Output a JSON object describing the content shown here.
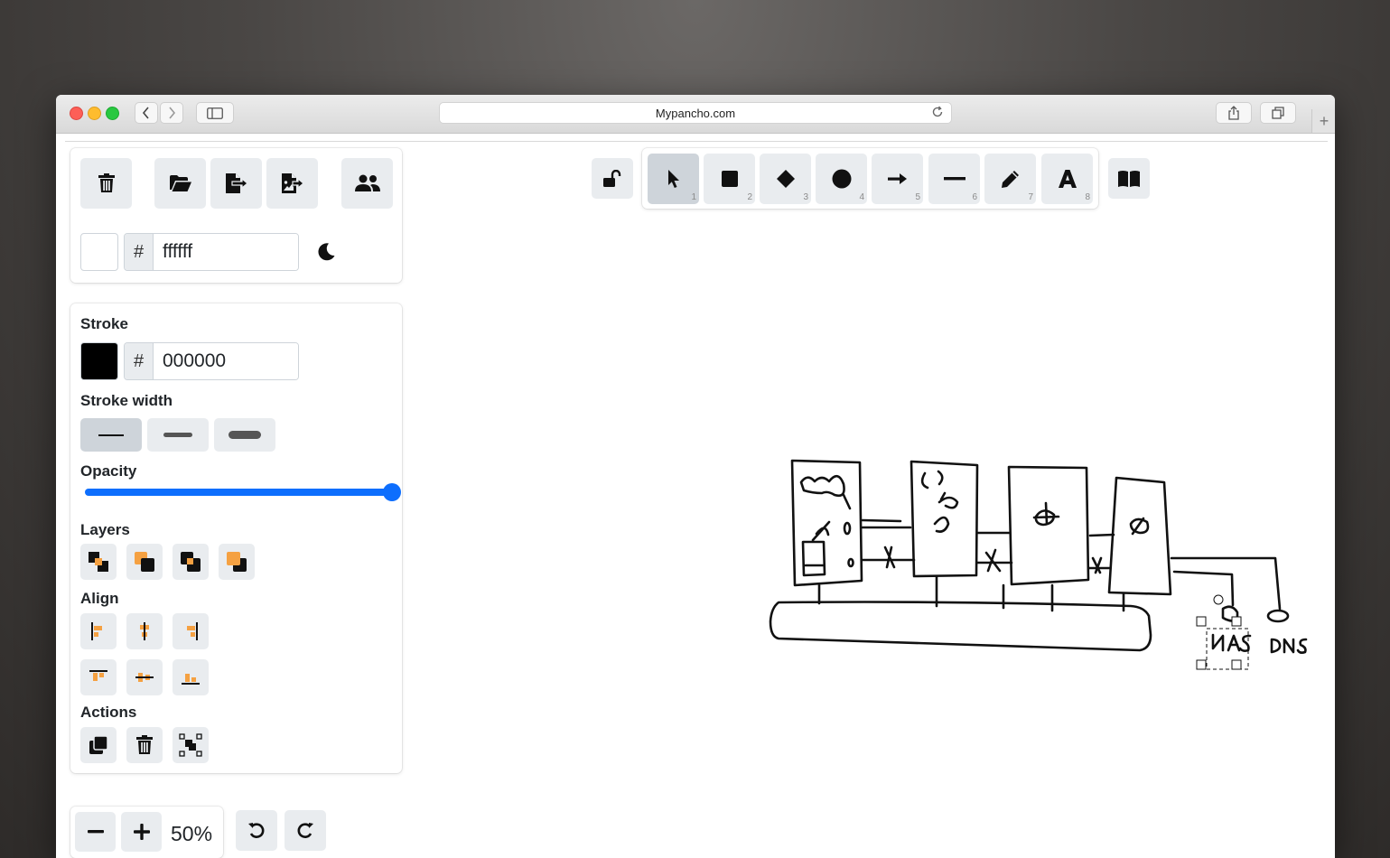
{
  "browser": {
    "url": "Mypancho.com"
  },
  "file_panel": {
    "background_hex": "ffffff",
    "background_color": "#ffffff",
    "icons": [
      "trash-icon",
      "folder-open-icon",
      "file-export-icon",
      "image-export-icon",
      "users-icon",
      "moon-icon"
    ]
  },
  "toolbar": {
    "tools": [
      {
        "name": "select",
        "icon": "pointer-icon",
        "shortcut": "1",
        "active": true
      },
      {
        "name": "rectangle",
        "icon": "square-icon",
        "shortcut": "2"
      },
      {
        "name": "diamond",
        "icon": "diamond-icon",
        "shortcut": "3"
      },
      {
        "name": "ellipse",
        "icon": "circle-icon",
        "shortcut": "4"
      },
      {
        "name": "arrow",
        "icon": "arrow-right-icon",
        "shortcut": "5"
      },
      {
        "name": "line",
        "icon": "minus-icon",
        "shortcut": "6"
      },
      {
        "name": "draw",
        "icon": "pencil-icon",
        "shortcut": "7"
      },
      {
        "name": "text",
        "icon": "text-icon",
        "shortcut": "8"
      }
    ],
    "lock_icon": "unlock-icon",
    "library_icon": "book-icon"
  },
  "props": {
    "stroke_label": "Stroke",
    "stroke_hex": "000000",
    "stroke_color": "#000000",
    "stroke_width_label": "Stroke width",
    "opacity_label": "Opacity",
    "opacity": 1.0,
    "layers_label": "Layers",
    "align_label": "Align",
    "actions_label": "Actions"
  },
  "zoom": {
    "value": "50%"
  },
  "colors": {
    "accent": "#0d6efd",
    "button_bg": "#e9ecef",
    "orange": "#f5a142"
  }
}
